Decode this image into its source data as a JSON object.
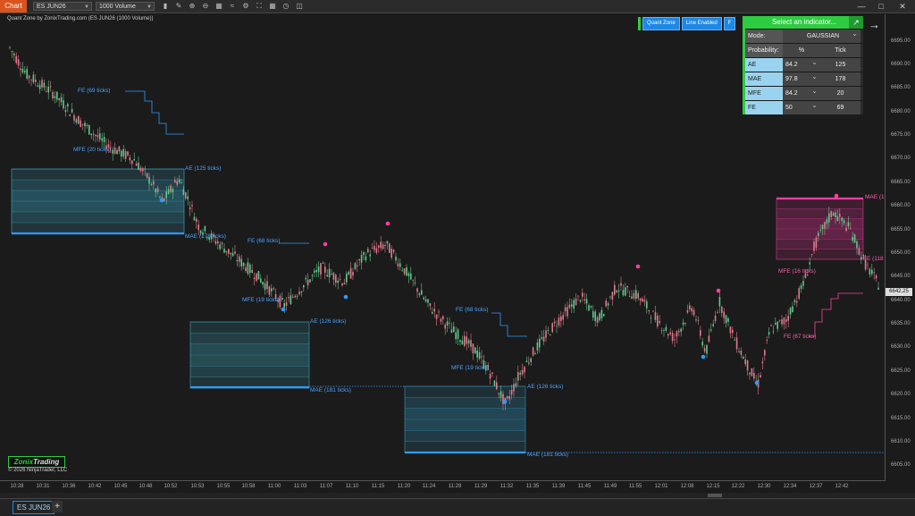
{
  "toolbar": {
    "chart_tab": "Chart",
    "instrument": "ES JUN26",
    "bar_type": "1000 Volume",
    "icons": [
      "bar-chart-icon",
      "draw-pencil-icon",
      "zoom-in-icon",
      "zoom-out-icon",
      "bar-properties-icon",
      "indicator-icon",
      "strategy-icon",
      "fullscreen-icon",
      "grid-icon",
      "clock-icon",
      "layout-icon"
    ],
    "window_buttons": [
      "—",
      "□",
      "✕"
    ]
  },
  "chart_title": "Quant Zone by ZonixTrading.com (ES JUN26 (1000 Volume))",
  "quant_buttons": [
    "Quant Zone",
    "Line Enabled",
    "F"
  ],
  "panel": {
    "select_label": "Select an indicator...",
    "mode_label": "Mode:",
    "mode_value": "GAUSSIAN",
    "prob_label": "Probability:",
    "pct_header": "%",
    "tick_header": "Tick",
    "rows": [
      {
        "name": "AE",
        "pct": "84.2",
        "tick": "125"
      },
      {
        "name": "MAE",
        "pct": "97.8",
        "tick": "178"
      },
      {
        "name": "MFE",
        "pct": "84.2",
        "tick": "20"
      },
      {
        "name": "FE",
        "pct": "50",
        "tick": "69"
      }
    ]
  },
  "price_axis": {
    "ticks": [
      "6695.00",
      "6690.00",
      "6685.00",
      "6680.00",
      "6675.00",
      "6670.00",
      "6665.00",
      "6660.00",
      "6655.00",
      "6650.00",
      "6645.00",
      "6640.00",
      "6635.00",
      "6630.00",
      "6625.00",
      "6620.00",
      "6615.00",
      "6610.00",
      "6605.00"
    ],
    "last_price": "6642.25"
  },
  "time_axis": [
    "10:28",
    "10:31",
    "10:36",
    "10:42",
    "10:45",
    "10:48",
    "10:52",
    "10:53",
    "10:55",
    "10:58",
    "11:00",
    "11:03",
    "11:07",
    "11:10",
    "11:15",
    "11:20",
    "11:24",
    "11:28",
    "11:29",
    "11:32",
    "11:35",
    "11:39",
    "11:45",
    "11:49",
    "11:55",
    "12:01",
    "12:08",
    "12:15",
    "12:22",
    "12:30",
    "12:34",
    "12:37",
    "12:42"
  ],
  "annotations": {
    "fe1": "FE (69 ticks)",
    "mfe1": "MFE (20 ticks)",
    "ae1": "AE (125 ticks)",
    "mae1": "MAE (178 ticks)",
    "fe2": "FE (68 ticks)",
    "mfe2": "MFE (19 ticks)",
    "ae2": "AE (126 ticks)",
    "mae2": "MAE (181 ticks)",
    "fe3": "FE (68 ticks)",
    "mfe3": "MFE (19 ticks)",
    "ae3": "AE (126 ticks)",
    "mae3": "MAE (181 ticks)",
    "mae4": "MAE (1",
    "fe4": "FE (118",
    "mfe4": "MFE (16 ticks)",
    "fe5": "FE (67 ticks)"
  },
  "logo_a": "Zonix",
  "logo_b": "Trading",
  "copyright": "© 2026 NinjaTrader, LLC",
  "bottom_tab": "ES JUN26",
  "add_tab": "+",
  "colors": {
    "up": "#5fc98a",
    "down": "#e07a8c",
    "zone_blue": "#2e9bff",
    "zone_pink": "#ff3fa0",
    "accent_green": "#2ecc40"
  }
}
